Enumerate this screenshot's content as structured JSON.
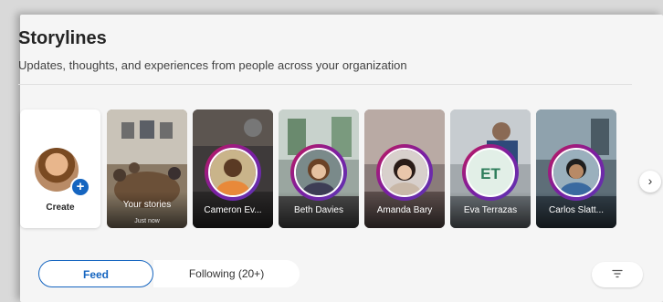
{
  "header": {
    "title": "Storylines",
    "subtitle": "Updates, thoughts, and experiences from people across your organization"
  },
  "create_tile": {
    "label": "Create",
    "icon": "plus-icon"
  },
  "stories": [
    {
      "name": "Your stories",
      "sub": "Just now",
      "type": "own"
    },
    {
      "name": "Cameron Ev...",
      "type": "photo"
    },
    {
      "name": "Beth Davies",
      "type": "photo"
    },
    {
      "name": "Amanda Bary",
      "type": "photo"
    },
    {
      "name": "Eva Terrazas",
      "initials": "ET",
      "type": "initials"
    },
    {
      "name": "Carlos Slatt...",
      "type": "photo"
    }
  ],
  "next_icon": "chevron-right-icon",
  "tabs": {
    "feed": "Feed",
    "following": "Following (20+)"
  },
  "filter_icon": "filter-icon",
  "colors": {
    "accent": "#1565c0",
    "story_ring": "#7b1fa2",
    "initials_bg": "#e2efe7",
    "initials_text": "#2e7d5b"
  }
}
